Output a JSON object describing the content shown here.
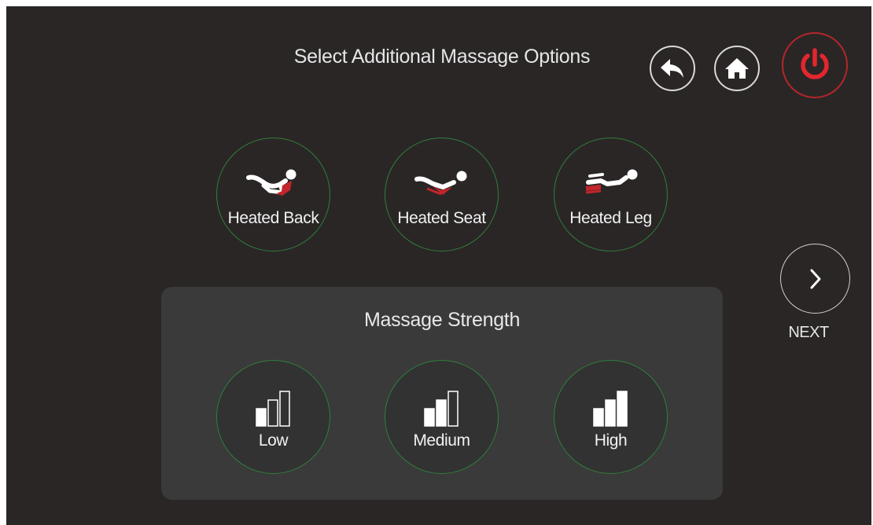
{
  "header": {
    "title": "Select Additional Massage Options"
  },
  "toolbar": {
    "back_icon": "back-arrow-icon",
    "home_icon": "home-icon",
    "power_icon": "power-icon",
    "power_color": "#e3262d"
  },
  "options": [
    {
      "label": "Heated Back",
      "icon": "heated-back-icon"
    },
    {
      "label": "Heated Seat",
      "icon": "heated-seat-icon"
    },
    {
      "label": "Heated Leg",
      "icon": "heated-leg-icon"
    }
  ],
  "strength": {
    "title": "Massage Strength",
    "levels": [
      {
        "label": "Low",
        "icon": "signal-low-icon",
        "filled_bars": 1
      },
      {
        "label": "Medium",
        "icon": "signal-medium-icon",
        "filled_bars": 2
      },
      {
        "label": "High",
        "icon": "signal-high-icon",
        "filled_bars": 3
      }
    ]
  },
  "navigation": {
    "next_label": "NEXT",
    "next_icon": "chevron-right-icon"
  },
  "colors": {
    "background": "#2a2626",
    "panel": "#3a3a3a",
    "accent_ring": "#2f7f3b",
    "heat_red": "#c4242b"
  }
}
